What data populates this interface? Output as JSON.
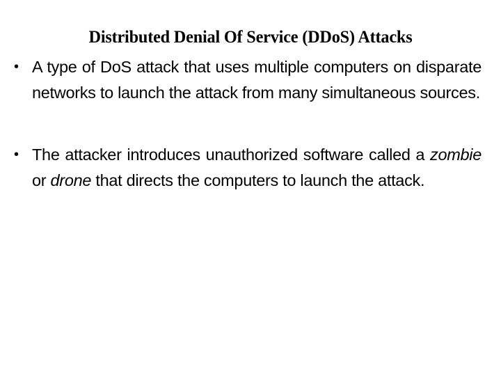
{
  "slide": {
    "title": "Distributed Denial Of Service (DDoS) Attacks",
    "bullets": [
      {
        "marker": "•",
        "text": "A type of DoS attack that uses multiple computers on disparate networks to launch the attack from many simultaneous sources."
      },
      {
        "marker": "•",
        "parts": {
          "t1": "The attacker introduces unauthorized software called a ",
          "em1": "zombie",
          "t2": " or ",
          "em2": "drone",
          "t3": " that directs the computers to launch the attack."
        }
      }
    ]
  }
}
